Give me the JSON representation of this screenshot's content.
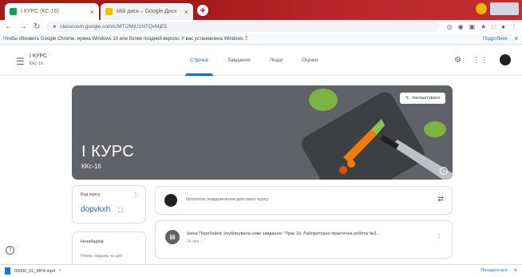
{
  "browser": {
    "tabs": [
      {
        "label": "I КУРС (КС-16)",
        "close": "×"
      },
      {
        "label": "Мій диск – Google Диск",
        "close": "×"
      }
    ],
    "new_tab": "+",
    "address": "classroom.google.com/c/MTI2MjU1NTQxMjE5",
    "infobar_text": "Чтобы обновить Google Chrome, нужна Windows 10 или более поздней версии. У вас установлена Windows 7.",
    "infobar_link": "Подробнее",
    "infobar_close": "×"
  },
  "app": {
    "course_name": "I КУРС",
    "course_section": "ККс-16",
    "nav_tabs": [
      "Стрічка",
      "Завдання",
      "Люди",
      "Оцінки"
    ],
    "active_tab": 0
  },
  "banner": {
    "title": "I КУРС",
    "section": "ККс-16",
    "customize_label": "Налаштувати",
    "info": "i"
  },
  "class_code": {
    "label": "Код курсу",
    "code": "dopvkxh",
    "more": "⋮",
    "expand": "⛶"
  },
  "upcoming": {
    "label": "Незабаром",
    "text": "Немає завдань на цей"
  },
  "post_box": {
    "placeholder": "Оголосіть повідомлення для свого курсу"
  },
  "stream": [
    {
      "icon": "📋",
      "text": "Ірина Перебийніс опублікувала нове завдання: \"Урок 16. Лабораторно-практична робота №3...",
      "date": "24 лют."
    }
  ],
  "downloads": {
    "file": "00000_01_MP4.mp4",
    "show_all": "Показати все",
    "close": "×"
  },
  "colors": {
    "accent": "#1967d2",
    "banner": "#5f6368",
    "browser_frame": "#a31a1a"
  }
}
